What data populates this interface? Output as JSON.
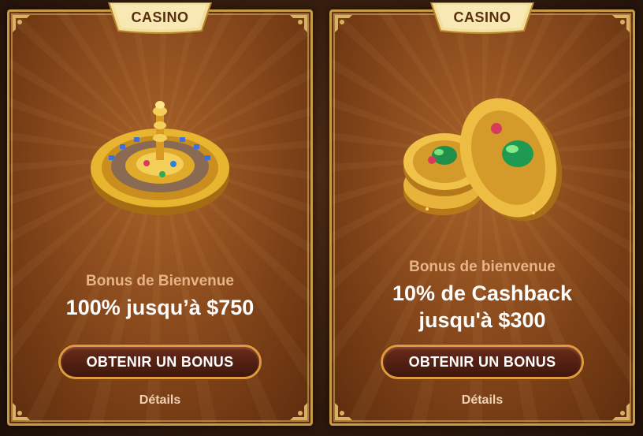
{
  "cards": [
    {
      "badge": "CASINO",
      "subtitle": "Bonus de Bienvenue",
      "headline_lines": [
        "100% jusqu’à $750"
      ],
      "cta_label": "OBTENIR UN BONUS",
      "details_label": "Détails",
      "art_icon": "golden-roulette-wheel"
    },
    {
      "badge": "CASINO",
      "subtitle": "Bonus de bienvenue",
      "headline_lines": [
        "10% de Cashback",
        "jusqu'à $300"
      ],
      "cta_label": "OBTENIR UN BONUS",
      "details_label": "Détails",
      "art_icon": "scarab-gold-coins"
    }
  ],
  "colors": {
    "card_bg": "#8a4a1c",
    "gold_border": "#c99a45",
    "subtitle_text": "#e7b487",
    "button_border": "#e09a3d"
  }
}
